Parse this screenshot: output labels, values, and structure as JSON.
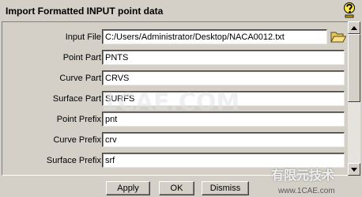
{
  "window": {
    "title": "Import Formatted INPUT point data"
  },
  "icons": {
    "help": "help-question-icon",
    "browse": "open-folder-icon"
  },
  "form": {
    "input_file": {
      "label": "Input File",
      "value": "C:/Users/Administrator/Desktop/NACA0012.txt"
    },
    "point_part": {
      "label": "Point Part",
      "value": "PNTS"
    },
    "curve_part": {
      "label": "Curve Part",
      "value": "CRVS"
    },
    "surface_part": {
      "label": "Surface Part",
      "value": "SURFS"
    },
    "point_prefix": {
      "label": "Point Prefix",
      "value": "pnt"
    },
    "curve_prefix": {
      "label": "Curve Prefix",
      "value": "crv"
    },
    "surface_prefix": {
      "label": "Surface Prefix",
      "value": "srf"
    }
  },
  "buttons": {
    "apply": "Apply",
    "ok": "OK",
    "dismiss": "Dismiss"
  },
  "watermarks": {
    "center": "1CAE.COM",
    "logo": "有限元技术",
    "url": "www.1CAE.com"
  }
}
